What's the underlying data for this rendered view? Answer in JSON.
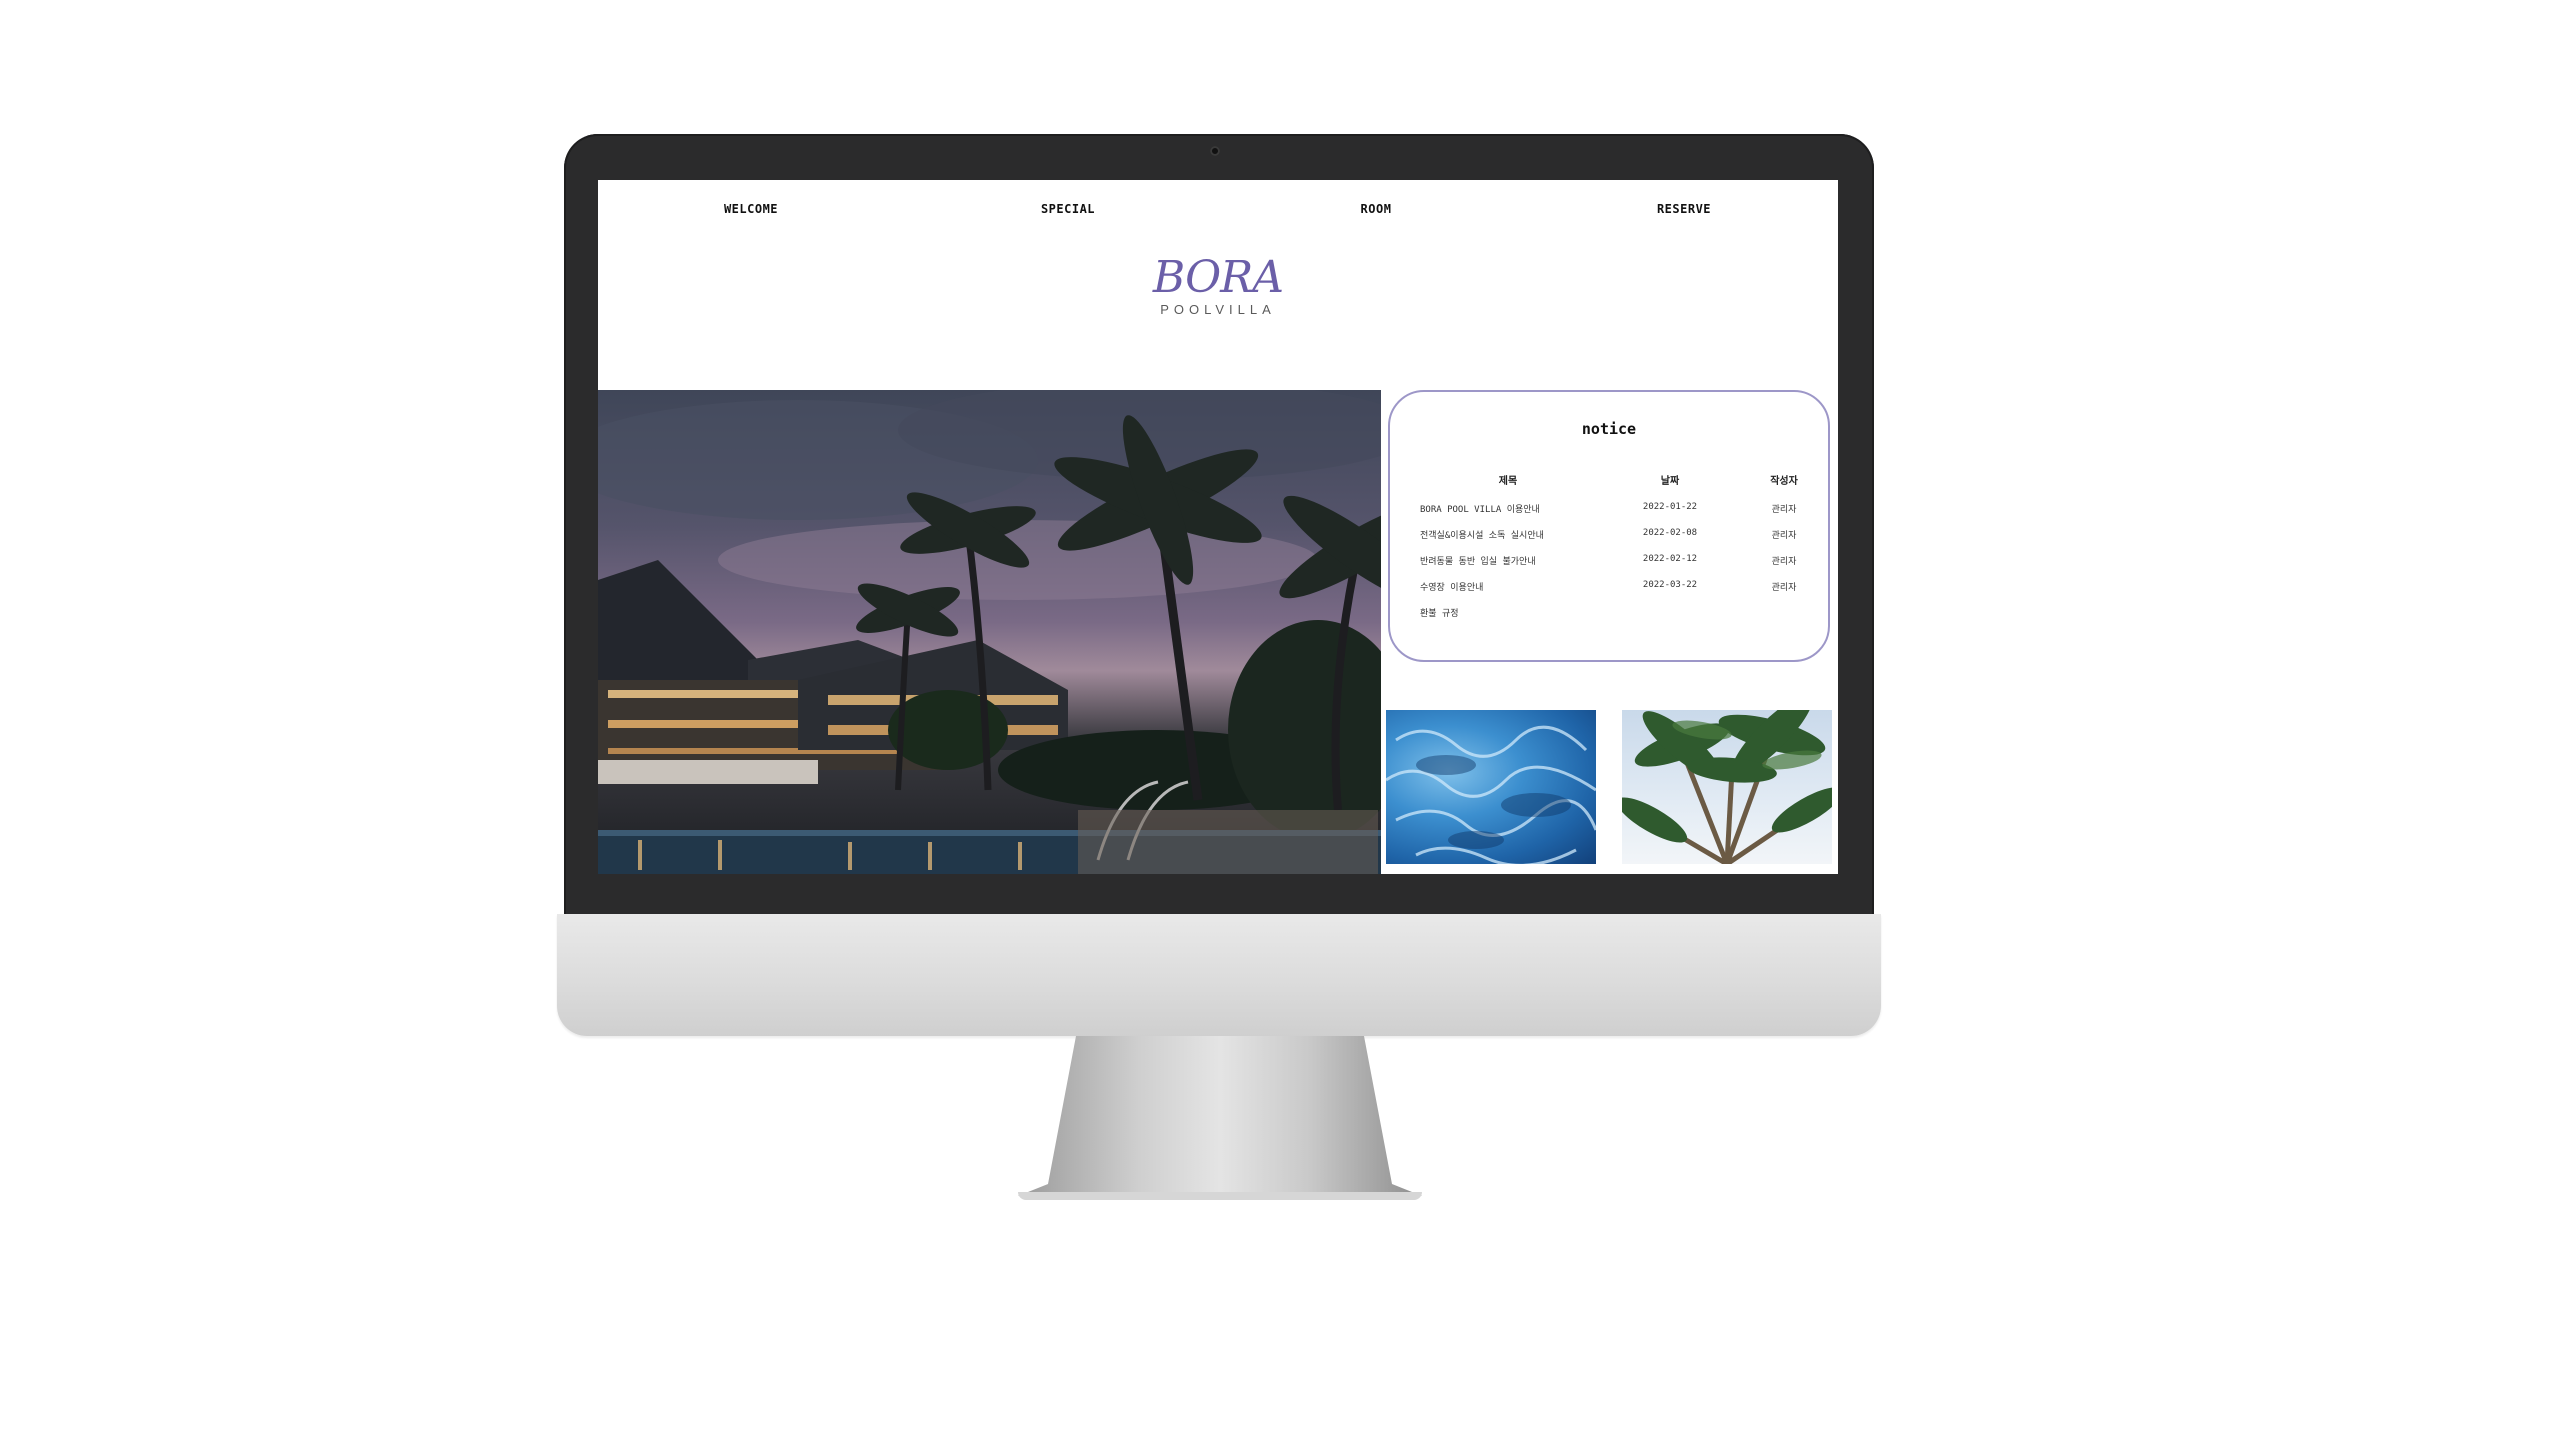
{
  "nav": {
    "items": [
      {
        "label": "WELCOME"
      },
      {
        "label": "SPECIAL"
      },
      {
        "label": "ROOM"
      },
      {
        "label": "RESERVE"
      }
    ]
  },
  "logo": {
    "main": "BORA",
    "sub": "POOLVILLA"
  },
  "notice": {
    "title": "notice",
    "headers": {
      "title": "제목",
      "date": "날짜",
      "author": "작성자"
    },
    "rows": [
      {
        "title": "BORA POOL VILLA 이용안내",
        "date": "2022-01-22",
        "author": "관리자"
      },
      {
        "title": "전객실&이용시설 소독 실시안내",
        "date": "2022-02-08",
        "author": "관리자"
      },
      {
        "title": "반려동물 동반 입실 불가안내",
        "date": "2022-02-12",
        "author": "관리자"
      },
      {
        "title": "수영장 이용안내",
        "date": "2022-03-22",
        "author": "관리자"
      },
      {
        "title": "환불 규정",
        "date": "",
        "author": ""
      }
    ]
  },
  "colors": {
    "brand": "#6b5fa8",
    "card_border": "#9d97c8",
    "bezel": "#2b2b2c"
  }
}
